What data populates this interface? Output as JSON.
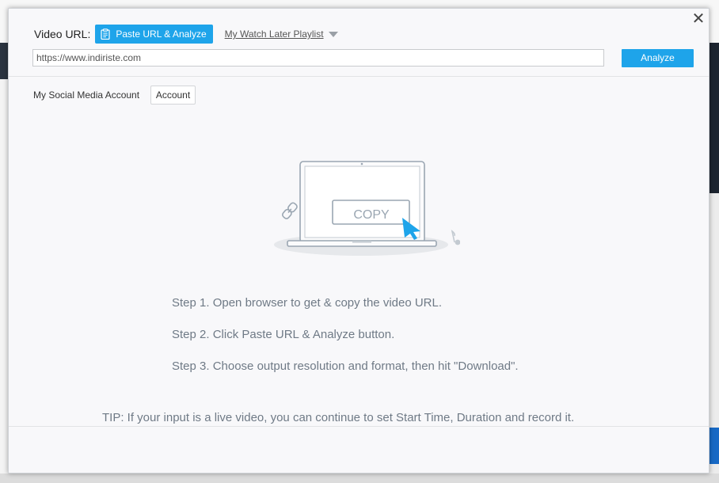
{
  "dialog": {
    "close_symbol": "✕",
    "video_url_label": "Video URL:",
    "paste_button_label": "Paste URL & Analyze",
    "watch_later_label": "My Watch Later Playlist",
    "url_input_value": "https://www.indiriste.com",
    "analyze_label": "Analyze",
    "social_label": "My Social Media Account",
    "account_label": "Account",
    "illustration_copy_text": "COPY",
    "steps": [
      "Step 1. Open browser to get & copy the video URL.",
      "Step 2. Click Paste URL & Analyze button.",
      "Step 3. Choose output resolution and format, then hit \"Download\"."
    ],
    "tip": "TIP: If your input is a live video, you can continue to set Start Time, Duration and record it."
  },
  "colors": {
    "accent_blue": "#1ea4ea",
    "illustration_gray": "#9aa6b2",
    "text_gray": "#6f7a86"
  },
  "icons": {
    "close": "close-icon",
    "paste": "clipboard-icon",
    "dropdown": "chevron-down-icon",
    "link": "link-icon",
    "cursor": "cursor-icon",
    "music": "music-note-icon"
  }
}
